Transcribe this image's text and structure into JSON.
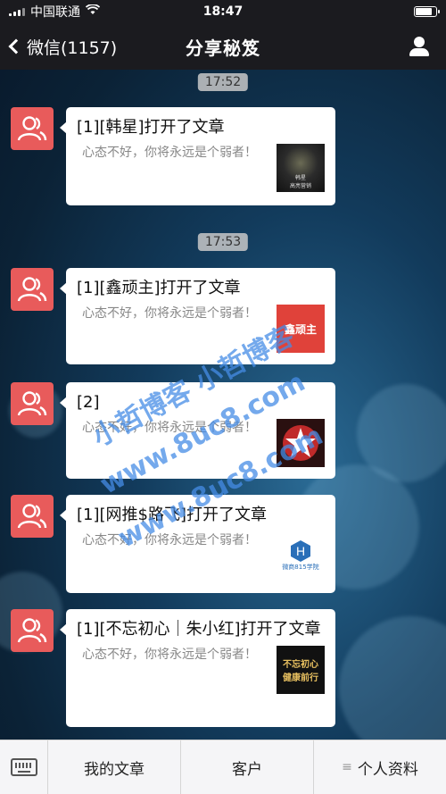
{
  "status_bar": {
    "carrier": "中国联通",
    "time": "18:47"
  },
  "nav": {
    "back_label": "微信(1157)",
    "title": "分享秘笈"
  },
  "timestamps": [
    "17:52",
    "17:53"
  ],
  "messages": [
    {
      "title": "[1][韩星]打开了文章",
      "desc": "心态不好，你将永远是个弱者！",
      "thumb_text": "韩星\n高亮营销"
    },
    {
      "title": "[1][鑫顽主]打开了文章",
      "desc": "心态不好，你将永远是个弱者！",
      "thumb_text": "鑫顽主"
    },
    {
      "title": "[2]",
      "desc": "心态不好，你将永远是个弱者！",
      "thumb_text": ""
    },
    {
      "title": "[1][网推$路飞]打开了文章",
      "desc": "心态不好，你将永远是个弱者！",
      "thumb_text": "微商815学院"
    },
    {
      "title": "[1][不忘初心｜朱小红]打开了文章",
      "desc": "心态不好，你将永远是个弱者！",
      "thumb_text": "不忘初心\n健康前行"
    }
  ],
  "watermark": {
    "line1": "小哲博客 小哲博客",
    "line2": "www.8uc8.com"
  },
  "bottom_menu": {
    "item1": "我的文章",
    "item2": "客户",
    "item3": "个人资料"
  },
  "colors": {
    "avatar": "#e85b5b",
    "bar": "#1b1b1f",
    "watermark": "#468ce6"
  }
}
